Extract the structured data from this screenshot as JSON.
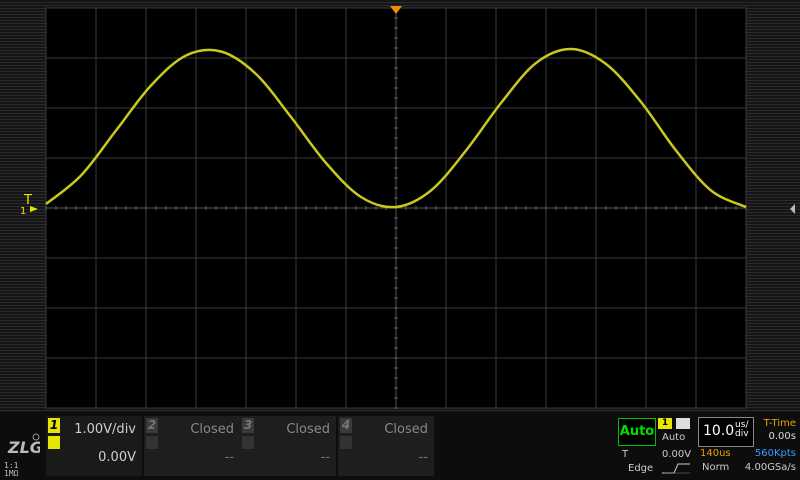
{
  "channels": [
    {
      "num": "1",
      "scale": "1.00V/div",
      "offset": "0.00V",
      "bandwidth": "",
      "active": true,
      "color": "#e6e600"
    },
    {
      "num": "2",
      "scale": "Closed",
      "offset": "--",
      "bandwidth": "",
      "active": false
    },
    {
      "num": "3",
      "scale": "Closed",
      "offset": "--",
      "bandwidth": "",
      "active": false
    },
    {
      "num": "4",
      "scale": "Closed",
      "offset": "--",
      "bandwidth": "",
      "active": false
    }
  ],
  "probe": {
    "ratio": "1:1",
    "impedance": "1MΩ"
  },
  "trigger": {
    "run_mode": "Auto",
    "source": "1",
    "mode": "Auto",
    "label": "T",
    "level": "0.00V",
    "type": "Edge",
    "marker_label": "T",
    "channel_marker": "1"
  },
  "timebase": {
    "value": "10.0",
    "unit_top": "us/",
    "unit_bottom": "div",
    "delay": "140us",
    "memory": "560Kpts",
    "acquire": "Norm",
    "sample_rate": "4.00GSa/s",
    "t_time_label": "T-Time",
    "t_time_value": "0.00s"
  },
  "colors": {
    "trace": "#c8c81e",
    "trigger_marker": "#f08c00",
    "auto_green": "#00e000"
  },
  "icons": {
    "logo": "zlg-logo",
    "edge": "rising-edge-icon"
  },
  "chart_data": {
    "type": "line",
    "waveform": "sine",
    "x": [
      0,
      5,
      10,
      15,
      20,
      25,
      30,
      35,
      40,
      45,
      50,
      55,
      60,
      65,
      70,
      75,
      80,
      85,
      90,
      95,
      100
    ],
    "y": [
      0.08,
      0.65,
      1.55,
      2.45,
      3.05,
      3.13,
      2.68,
      1.82,
      0.9,
      0.22,
      0.02,
      0.35,
      1.15,
      2.1,
      2.9,
      3.18,
      2.88,
      2.12,
      1.15,
      0.35,
      0.02
    ],
    "xlim": [
      0,
      100
    ],
    "ylim": [
      -4,
      4
    ],
    "grid": true
  }
}
